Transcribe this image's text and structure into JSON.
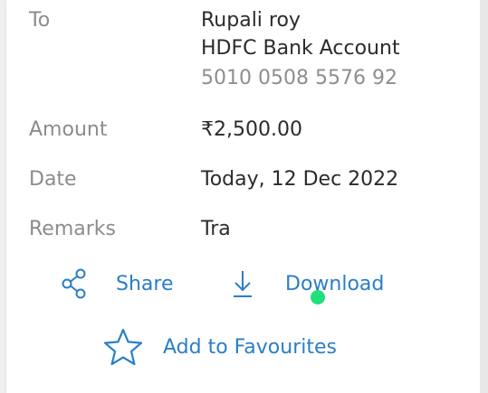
{
  "details": {
    "to": {
      "label": "To",
      "name": "Rupali roy",
      "bank": "HDFC Bank Account",
      "account_number": "5010 0508 5576 92"
    },
    "amount": {
      "label": "Amount",
      "value": "₹2,500.00"
    },
    "date": {
      "label": "Date",
      "value": "Today, 12 Dec 2022"
    },
    "remarks": {
      "label": "Remarks",
      "value": "Tra"
    }
  },
  "actions": {
    "share_label": "Share",
    "download_label": "Download",
    "favourites_label": "Add to Favourites"
  },
  "icons": {
    "share": "share-icon",
    "download": "download-icon",
    "favourites": "star-icon"
  },
  "colors": {
    "accent": "#2a7ec7",
    "label": "#8c8c8c",
    "value": "#2b2b2b",
    "touch_indicator": "#1fe07a"
  }
}
